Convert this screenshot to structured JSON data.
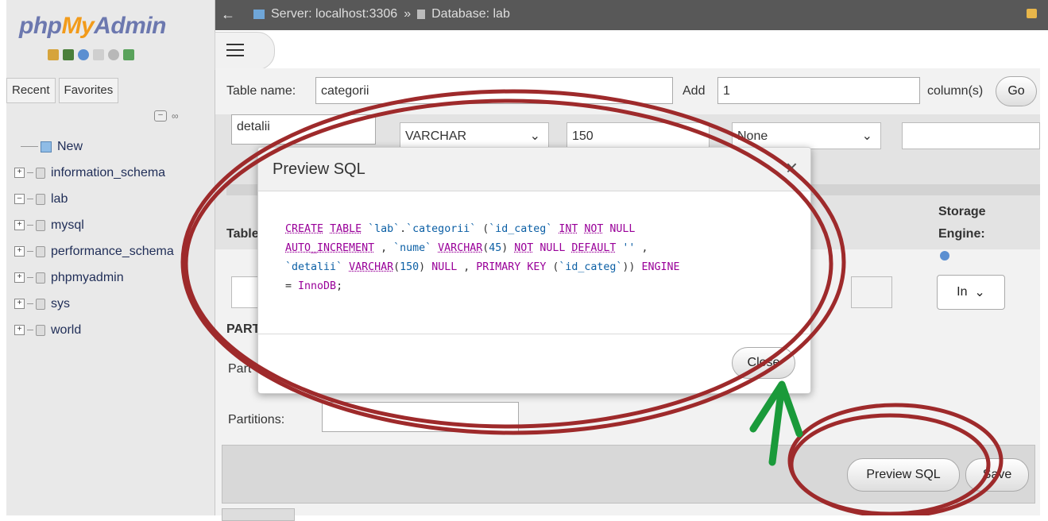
{
  "nav": {
    "logo": {
      "php": "php",
      "my": "My",
      "admin": "Admin"
    },
    "tabs": [
      "Recent",
      "Favorites"
    ],
    "tree": [
      {
        "label": "New",
        "type": "new"
      },
      {
        "label": "information_schema",
        "type": "db"
      },
      {
        "label": "lab",
        "type": "db-open"
      },
      {
        "label": "mysql",
        "type": "db"
      },
      {
        "label": "performance_schema",
        "type": "db"
      },
      {
        "label": "phpmyadmin",
        "type": "db"
      },
      {
        "label": "sys",
        "type": "db"
      },
      {
        "label": "world",
        "type": "db"
      }
    ]
  },
  "topbar": {
    "server": "Server: localhost:3306",
    "separator": "»",
    "database": "Database: lab"
  },
  "form": {
    "table_name_label": "Table name:",
    "table_name_value": "categorii",
    "add_label": "Add",
    "add_value": "1",
    "columns_label": "column(s)",
    "go_label": "Go",
    "column_name_value": "detalii",
    "type_value": "VARCHAR",
    "length_value": "150",
    "default_value": "None",
    "table_comments_label": "Table",
    "storage_engine_label_1": "Storage",
    "storage_engine_label_2": "Engine:",
    "engine_value": "In",
    "partition_label": "PART",
    "partition_by_label": "Part",
    "partitions_label": "Partitions:",
    "preview_sql_label": "Preview SQL",
    "save_label": "Save"
  },
  "modal": {
    "title": "Preview SQL",
    "close_x": "×",
    "close_label": "Close",
    "sql_lines": [
      "CREATE TABLE `lab`.`categorii` (`id_categ` INT NOT NULL",
      "AUTO_INCREMENT , `nume` VARCHAR(45) NOT NULL DEFAULT '' ,",
      "`detalii` VARCHAR(150) NULL , PRIMARY KEY (`id_categ`)) ENGINE",
      "= InnoDB;"
    ]
  },
  "colors": {
    "annotation_red": "#9e2a2b",
    "annotation_green": "#1a9a3a",
    "logo_blue": "#6c78af",
    "logo_orange": "#f29b1b"
  }
}
